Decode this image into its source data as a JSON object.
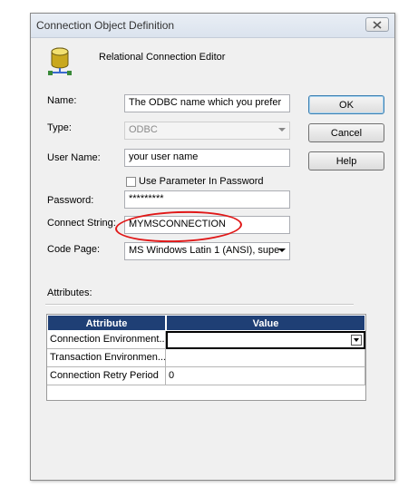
{
  "window": {
    "title": "Connection Object Definition",
    "close_icon": "close-icon"
  },
  "header": {
    "icon": "database-icon",
    "title": "Relational Connection Editor"
  },
  "form": {
    "name_label": "Name:",
    "name_value": "The ODBC name which you prefer",
    "type_label": "Type:",
    "type_value": "ODBC",
    "username_label": "User Name:",
    "username_value": "your user name",
    "use_param_label": "Use Parameter In Password",
    "password_label": "Password:",
    "password_value": "*********",
    "connect_string_label": "Connect String:",
    "connect_string_value": "MYMSCONNECTION",
    "code_page_label": "Code Page:",
    "code_page_value": "MS Windows Latin 1 (ANSI), supe"
  },
  "buttons": {
    "ok": "OK",
    "cancel": "Cancel",
    "help": "Help"
  },
  "attributes": {
    "label": "Attributes:",
    "columns": [
      "Attribute",
      "Value"
    ],
    "rows": [
      {
        "attribute": "Connection Environment...",
        "value": ""
      },
      {
        "attribute": "Transaction Environmen...",
        "value": ""
      },
      {
        "attribute": "Connection Retry Period",
        "value": "0"
      }
    ]
  },
  "colors": {
    "header_bg": "#1f3f75",
    "highlight": "#e01818"
  }
}
